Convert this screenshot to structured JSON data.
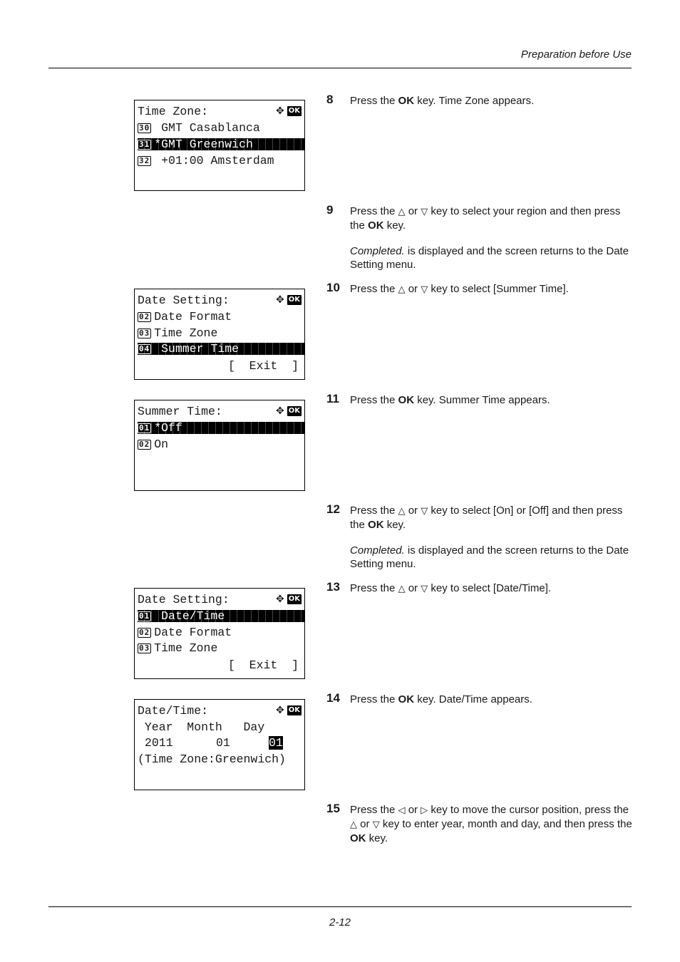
{
  "header": {
    "title": "Preparation before Use"
  },
  "footer": {
    "page_number": "2-12"
  },
  "icons": {
    "nav": "✥",
    "ok": "OK",
    "up": "△",
    "down": "▽",
    "left": "◁",
    "right": "▷"
  },
  "screens": [
    {
      "title": "Time Zone:",
      "lines": [
        {
          "num": "30",
          "text": " GMT Casablanca",
          "selected": false
        },
        {
          "num": "31",
          "text": "*GMT Greenwich",
          "selected": true
        },
        {
          "num": "32",
          "text": " +01:00 Amsterdam",
          "selected": false
        }
      ]
    },
    {
      "title": "Date Setting:",
      "lines": [
        {
          "num": "02",
          "text": "Date Format",
          "selected": false
        },
        {
          "num": "03",
          "text": "Time Zone",
          "selected": false
        },
        {
          "num": "04",
          "text": " Summer Time",
          "selected": true
        }
      ],
      "exit": "[  Exit  ]"
    },
    {
      "title": "Summer Time:",
      "lines": [
        {
          "num": "01",
          "text": "*Off",
          "selected": true
        },
        {
          "num": "02",
          "text": "On",
          "selected": false
        }
      ]
    },
    {
      "title": "Date Setting:",
      "lines": [
        {
          "num": "01",
          "text": " Date/Time",
          "selected": true
        },
        {
          "num": "02",
          "text": "Date Format",
          "selected": false
        },
        {
          "num": "03",
          "text": "Time Zone",
          "selected": false
        }
      ],
      "exit": "[  Exit  ]"
    },
    {
      "title": "Date/Time:",
      "headers": " Year  Month   Day",
      "year": "2011",
      "month": "01",
      "day": "01",
      "timezone": "(Time Zone:Greenwich)"
    }
  ],
  "steps": [
    {
      "num": "8",
      "parts": [
        "Press the ",
        "OK",
        " key. Time Zone appears."
      ]
    },
    {
      "num": "9",
      "parts": [
        "Press the ",
        " or ",
        " key to select your region and then press the ",
        "OK",
        " key."
      ],
      "note_italic": "Completed.",
      "note_rest": " is displayed and the screen returns to the Date Setting menu."
    },
    {
      "num": "10",
      "parts": [
        "Press the ",
        " or ",
        " key to select [Summer Time]."
      ]
    },
    {
      "num": "11",
      "parts": [
        "Press the ",
        "OK",
        " key. Summer Time appears."
      ]
    },
    {
      "num": "12",
      "parts": [
        "Press the ",
        " or ",
        " key to select [On] or [Off] and then press the ",
        "OK",
        " key."
      ],
      "note_italic": "Completed.",
      "note_rest": " is displayed and the screen returns to the Date Setting menu."
    },
    {
      "num": "13",
      "parts": [
        "Press the ",
        " or ",
        " key to select [Date/Time]."
      ]
    },
    {
      "num": "14",
      "parts": [
        "Press the ",
        "OK",
        " key. Date/Time appears."
      ]
    },
    {
      "num": "15",
      "parts": [
        "Press the ",
        " or ",
        " key to move the cursor position, press the ",
        " or ",
        " key to enter year, month and day, and then press the ",
        "OK",
        " key."
      ]
    }
  ]
}
